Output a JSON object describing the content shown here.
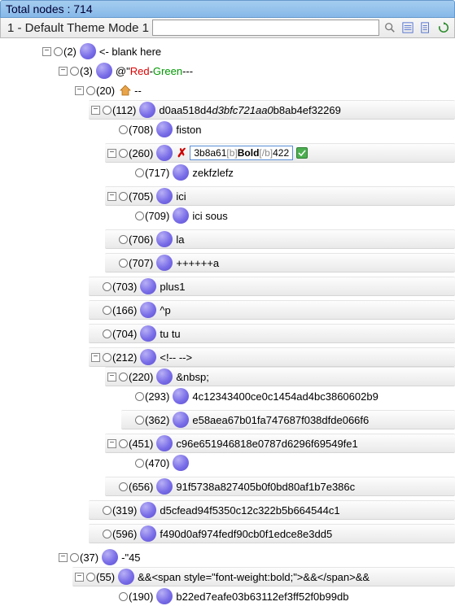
{
  "header": {
    "total_label": "Total nodes : 714"
  },
  "subheader": {
    "title": "1 - Default Theme Mode 1",
    "search_value": ""
  },
  "icons": {
    "search": "search-icon",
    "list": "list-icon",
    "doc": "doc-icon",
    "refresh": "refresh-icon"
  },
  "nodes": {
    "n2": {
      "id": "(2)",
      "label": "<- blank here"
    },
    "n3": {
      "id": "(3)",
      "at": "@",
      "q": "\"",
      "red": "Red",
      "dash1": "-",
      "green": "Green",
      "dash2": "---"
    },
    "n20": {
      "id": "(20)",
      "label": "--"
    },
    "n112": {
      "id": "(112)",
      "label": "d0aa518d4",
      "ital": "d3bfc721aa0",
      "tail": "b8ab4ef32269"
    },
    "n708": {
      "id": "(708)",
      "label": "fiston"
    },
    "n260": {
      "id": "(260)",
      "e1": "3b8a61",
      "e2": "[b]",
      "e3": "Bold",
      "e4": "[/b]",
      "e5": "422"
    },
    "n717": {
      "id": "(717)",
      "label": "zekfzlefz"
    },
    "n705": {
      "id": "(705)",
      "label": "ici"
    },
    "n709": {
      "id": "(709)",
      "label": "ici sous"
    },
    "n706": {
      "id": "(706)",
      "label": "la"
    },
    "n707": {
      "id": "(707)",
      "label": "++++++a"
    },
    "n703": {
      "id": "(703)",
      "label": "plus1"
    },
    "n166": {
      "id": "(166)",
      "label": "^p"
    },
    "n704": {
      "id": "(704)",
      "label": "tu tu"
    },
    "n212": {
      "id": "(212)",
      "label": "<!-- -->"
    },
    "n220": {
      "id": "(220)",
      "label": "&nbsp;"
    },
    "n293": {
      "id": "(293)",
      "label": "4c12343400ce0c1454ad4bc3860602b9"
    },
    "n362": {
      "id": "(362)",
      "label": "e58aea67b01fa747687f038dfde066f6"
    },
    "n451": {
      "id": "(451)",
      "label": "c96e651946818e0787d6296f69549fe1"
    },
    "n470": {
      "id": "(470)",
      "label": ""
    },
    "n656": {
      "id": "(656)",
      "label": "91f5738a827405b0f0bd80af1b7e386c"
    },
    "n319": {
      "id": "(319)",
      "label": "d5cfead94f5350c12c322b5b664544c1"
    },
    "n596": {
      "id": "(596)",
      "label": "f490d0af974fedf90cb0f1edce8e3dd5"
    },
    "n37": {
      "id": "(37)",
      "label": "-\"45"
    },
    "n55": {
      "id": "(55)",
      "label": "&&<span style=\"font-weight:bold;\">&&</span>&&"
    },
    "n190": {
      "id": "(190)",
      "label": "b22ed7eafe03b63112ef3ff52f0b99db"
    }
  }
}
